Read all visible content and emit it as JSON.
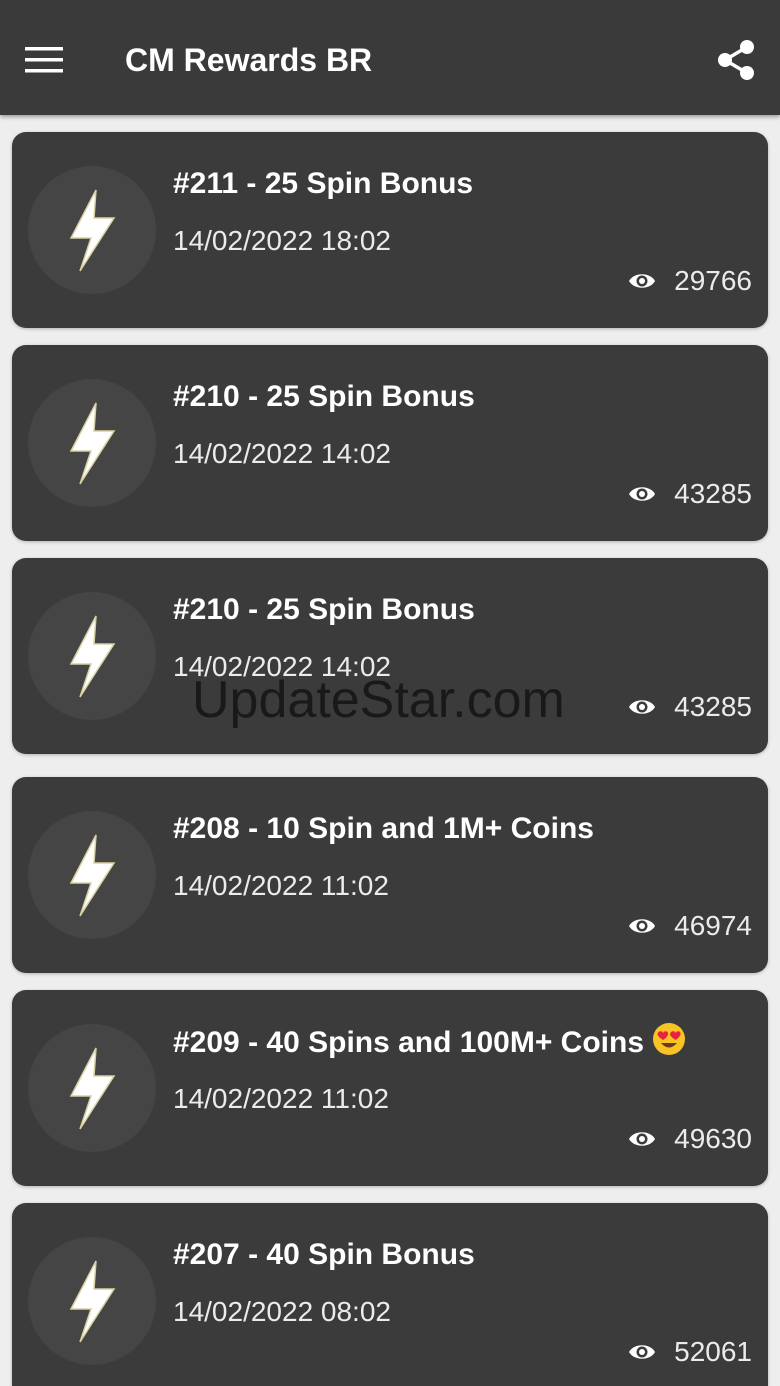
{
  "header": {
    "title": "CM Rewards BR",
    "menu_icon": "hamburger-menu-icon",
    "share_icon": "share-icon"
  },
  "colors": {
    "appbar": "#3a3a3a",
    "card": "#3b3b3b",
    "background": "#eeeeee",
    "text": "#ffffff"
  },
  "rewards": [
    {
      "title": "#211 - 25 Spin Bonus",
      "date": "14/02/2022 18:02",
      "views": "29766",
      "icon": "lightning-bolt-icon"
    },
    {
      "title": "#210 - 25 Spin Bonus",
      "date": "14/02/2022 14:02",
      "views": "43285",
      "icon": "lightning-bolt-icon"
    },
    {
      "title": "#210 - 25 Spin Bonus",
      "date": "14/02/2022 14:02",
      "views": "43285",
      "icon": "lightning-bolt-icon"
    },
    {
      "title": "#208 - 10 Spin and 1M+ Coins",
      "date": "14/02/2022 11:02",
      "views": "46974",
      "icon": "lightning-bolt-icon"
    },
    {
      "title": "#209 - 40 Spins and 100M+ Coins",
      "title_emoji": "heart-eyes-emoji",
      "date": "14/02/2022 11:02",
      "views": "49630",
      "icon": "lightning-bolt-icon"
    },
    {
      "title": "#207 - 40 Spin Bonus",
      "date": "14/02/2022 08:02",
      "views": "52061",
      "icon": "lightning-bolt-icon"
    }
  ],
  "watermark": "UpdateStar.com"
}
